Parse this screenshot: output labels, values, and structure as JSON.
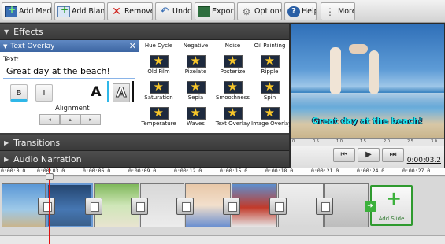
{
  "toolbar": {
    "buttons": [
      {
        "label": "Add Media",
        "icon": "add-media-icon"
      },
      {
        "label": "Add Blank",
        "icon": "add-blank-icon"
      },
      {
        "label": "Remove",
        "icon": "remove-icon"
      },
      {
        "label": "Undo",
        "icon": "undo-icon"
      },
      {
        "label": "Export",
        "icon": "export-icon"
      },
      {
        "label": "Options",
        "icon": "options-icon"
      },
      {
        "label": "Help",
        "icon": "help-icon"
      },
      {
        "label": "More",
        "icon": "more-icon"
      }
    ]
  },
  "effects": {
    "title": "Effects",
    "overlay": {
      "title": "Text Overlay",
      "text_label": "Text:",
      "text_value": "Great day at the beach!",
      "bold": "B",
      "italic": "I",
      "color_a": "A",
      "outline_a": "A",
      "alignment_label": "Alignment"
    },
    "grid": [
      "Hue Cycle",
      "Negative",
      "Noise",
      "Oil Painting",
      "Old Film",
      "Pixelate",
      "Posterize",
      "Ripple",
      "Saturation",
      "Sepia",
      "Smoothness",
      "Spin",
      "Temperature",
      "Waves",
      "Text Overlay",
      "Image Overlay"
    ]
  },
  "sections": {
    "transitions": "Transitions",
    "audio_narration": "Audio Narration"
  },
  "preview": {
    "overlay_text": "Great day at the beach!",
    "ruler": [
      "0",
      "0.5",
      "1.0",
      "1.5",
      "2.0",
      "2.5",
      "3.0"
    ],
    "time": "0:00:03.2"
  },
  "timeline": {
    "ticks": [
      "0:00:0.0",
      "0:00:03.0",
      "0:00:06.0",
      "0:00:09.0",
      "0:00:12.0",
      "0:00:15.0",
      "0:00:18.0",
      "0:00:21.0",
      "0:00:24.0",
      "0:00:27.0"
    ],
    "add_slide": "Add Slide"
  },
  "colors": {
    "accent": "#2fb7e8",
    "overlay_text": "#22e8f0",
    "playhead": "#e01010",
    "add_slide": "#3bb13b"
  }
}
